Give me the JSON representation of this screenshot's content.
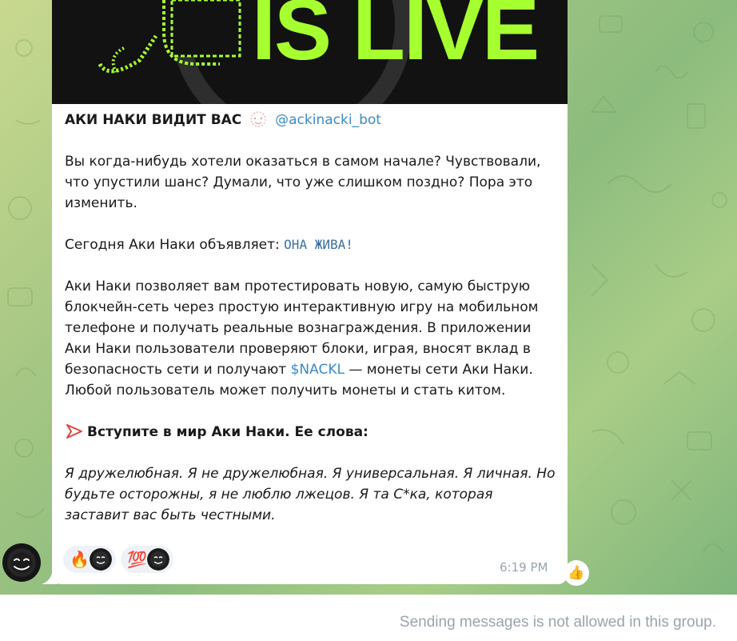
{
  "hero": {
    "text": "IS LIVE"
  },
  "message": {
    "title": "АКИ НАКИ ВИДИТ ВАС",
    "mention": "@ackinacki_bot",
    "para1": "Вы когда-нибудь хотели оказаться в самом начале? Чувствовали, что упустили шанс? Думали, что уже слишком поздно? Пора это изменить.",
    "para2_prefix": "Сегодня Аки Наки объявляет: ",
    "para2_code": "ОНА ЖИВА!",
    "para3_prefix": "Аки Наки позволяет вам протестировать новую, самую быструю блокчейн-сеть через простую интерактивную игру на мобильном телефоне и получать реальные вознаграждения. В приложении Аки Наки пользователи проверяют блоки, играя, вносят вклад в безопасность сети и получают ",
    "para3_link": "$NACKL",
    "para3_suffix": " — монеты сети Аки Наки. Любой пользователь может получить монеты и стать китом.",
    "heading": "Вступите в мир Аки Наки. Ее слова:",
    "quote": "Я дружелюбная. Я не дружелюбная. Я универсальная. Я личная. Но будьте осторожны, я не люблю лжецов. Я та С*ка, которая заставит вас быть честными."
  },
  "reactions": [
    {
      "emoji": "🔥",
      "icon": "fire-icon"
    },
    {
      "emoji": "💯",
      "icon": "hundred-points-icon"
    }
  ],
  "timestamp": "6:19 PM",
  "like_button": {
    "emoji": "👍",
    "icon": "thumbs-up-icon"
  },
  "footer": {
    "note": "Sending messages is not allowed in this group."
  },
  "colors": {
    "accent_link": "#3a8bc8",
    "hero_green": "#a6ff2e",
    "muted_text": "#9aa4ae"
  }
}
